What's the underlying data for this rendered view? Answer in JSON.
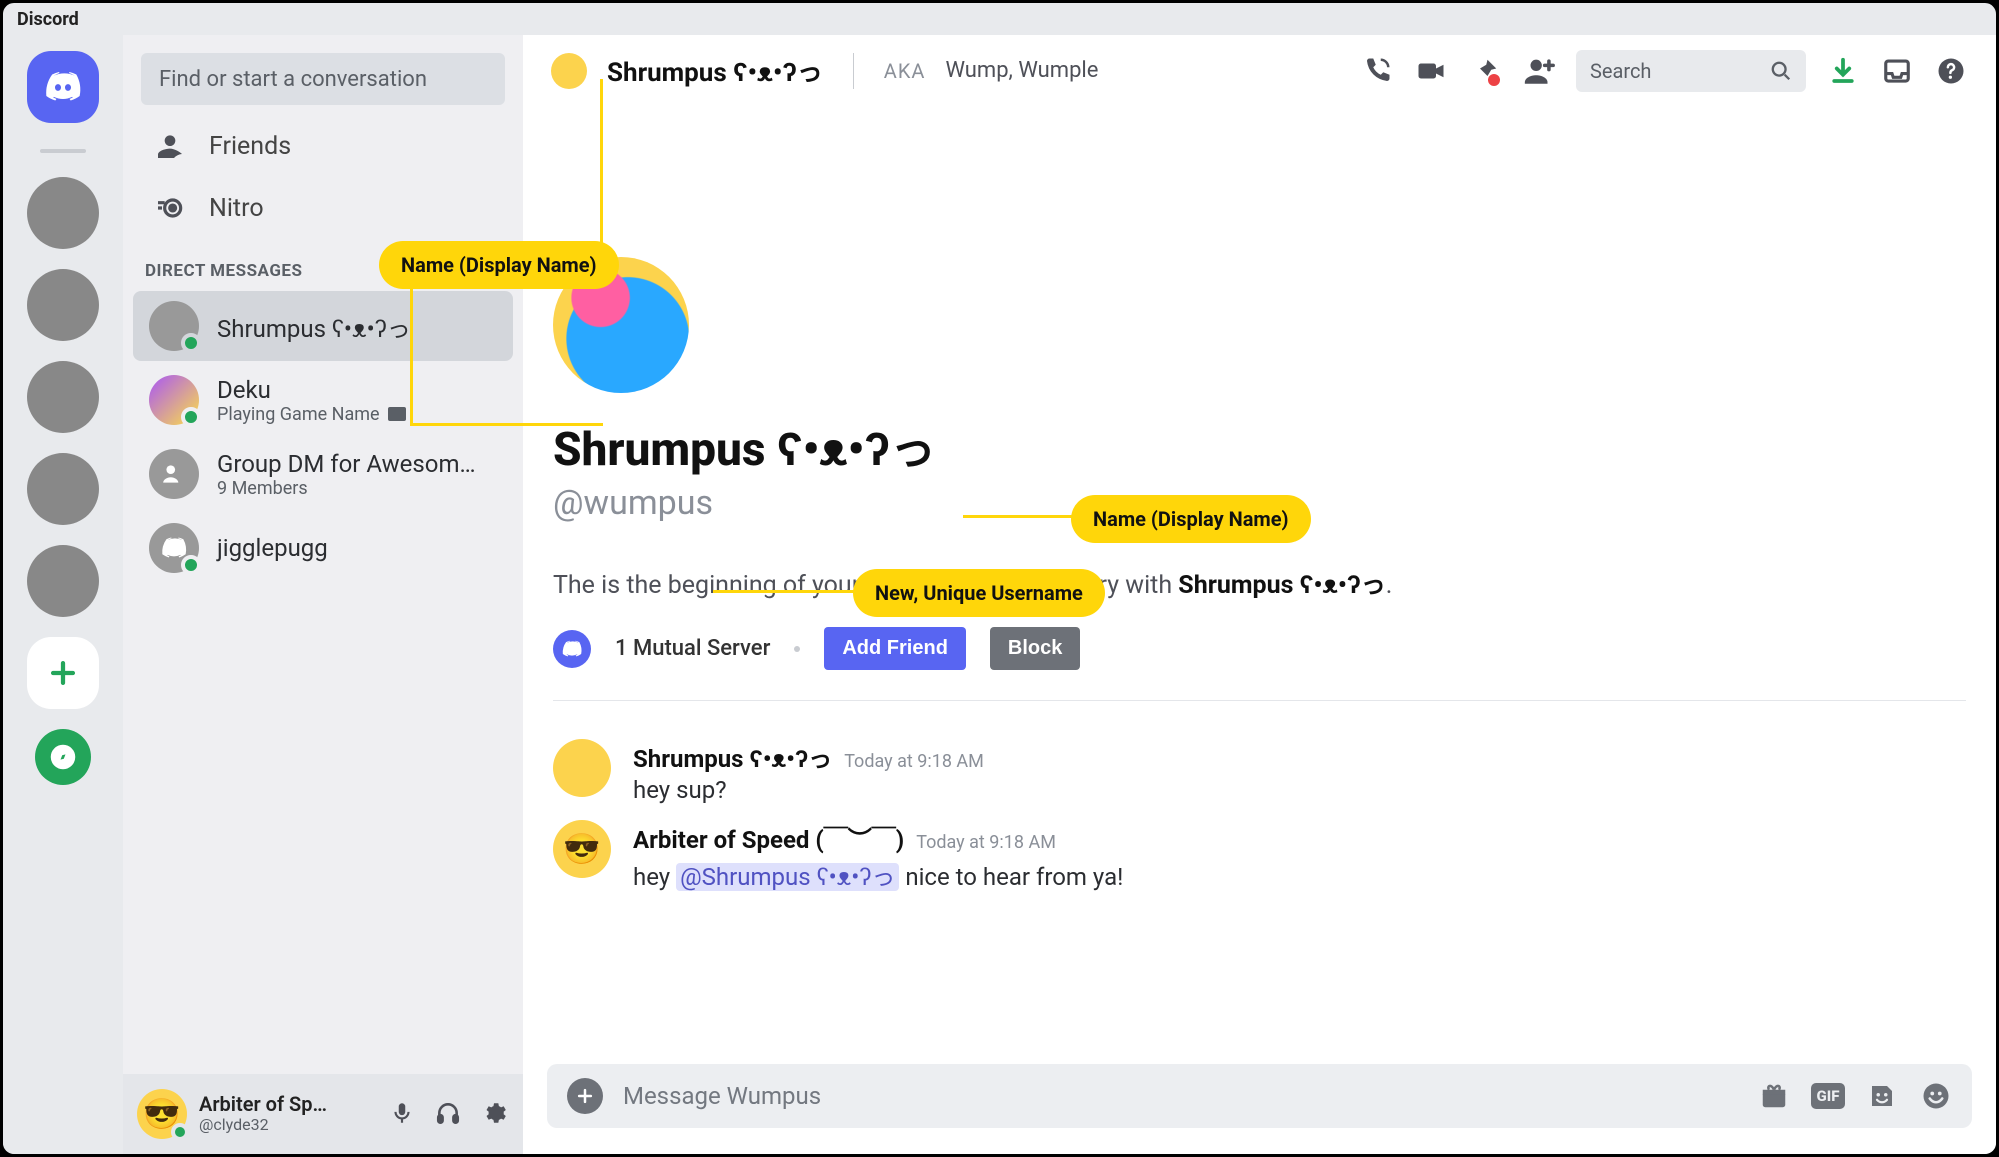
{
  "app_title": "Discord",
  "sidebar": {
    "search_placeholder": "Find or start a conversation",
    "nav": {
      "friends": "Friends",
      "nitro": "Nitro"
    },
    "section_title": "DIRECT MESSAGES",
    "dms": [
      {
        "name": "Shrumpus ʕ•ᴥ•ʔっ",
        "sub": ""
      },
      {
        "name": "Deku",
        "sub": "Playing Game Name"
      },
      {
        "name": "Group DM for Awesom…",
        "sub": "9 Members"
      },
      {
        "name": "jigglepugg",
        "sub": ""
      }
    ]
  },
  "userpanel": {
    "name": "Arbiter of Sp…",
    "handle": "@clyde32"
  },
  "topbar": {
    "title": "Shrumpus ʕ•ᴥ•ʔっ",
    "aka_label": "AKA",
    "aka_value": "Wump, Wumple",
    "search_placeholder": "Search"
  },
  "profile": {
    "display_name": "Shrumpus ʕ•ᴥ•ʔっ",
    "username": "@wumpus",
    "begin_prefix": "The is the beginning of your direct message history with ",
    "begin_name": "Shrumpus ʕ•ᴥ•ʔっ",
    "begin_suffix": ".",
    "mutual": "1 Mutual Server",
    "add_friend": "Add Friend",
    "block": "Block"
  },
  "messages": [
    {
      "author": "Shrumpus ʕ•ᴥ•ʔっ",
      "timestamp": "Today at 9:18 AM",
      "text": "hey sup?"
    },
    {
      "author": "Arbiter of Speed (￣︶￣)",
      "timestamp": "Today at 9:18 AM",
      "text_pre": "hey ",
      "mention": "@Shrumpus ʕ•ᴥ•ʔっ",
      "text_post": " nice to hear from ya!"
    }
  ],
  "composer": {
    "placeholder": "Message Wumpus"
  },
  "callouts": {
    "header_name": "Name (Display Name)",
    "profile_name": "Name (Display Name)",
    "username": "New, Unique  Username"
  }
}
